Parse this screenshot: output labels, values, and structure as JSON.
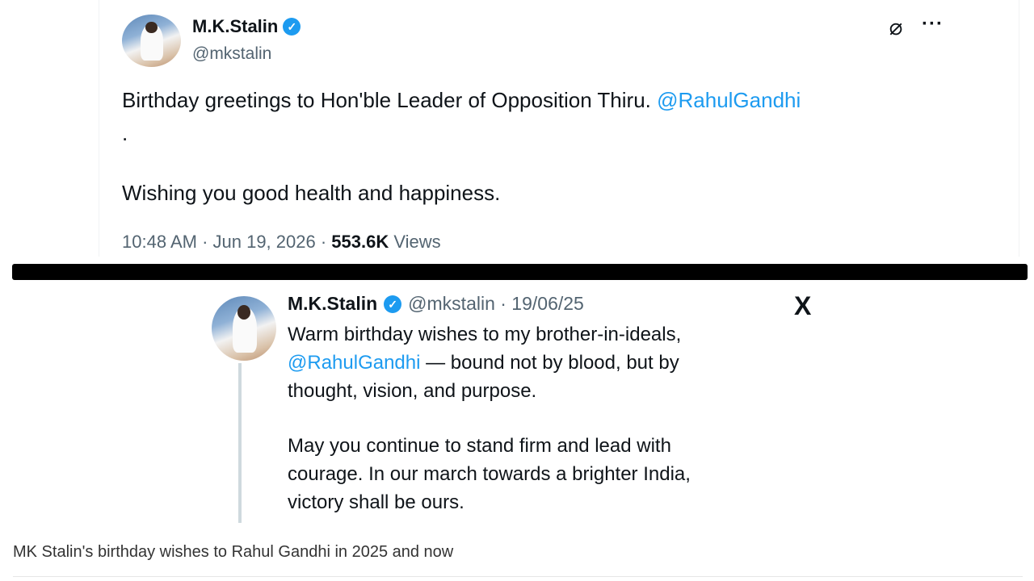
{
  "tweet_current": {
    "name": "M.K.Stalin",
    "verified_mark": "✓",
    "handle": "@mkstalin",
    "text_line1": "Birthday greetings to Hon'ble Leader of Opposition Thiru. ",
    "mention": "@RahulGandhi",
    "text_dot": ".",
    "text_line2": "Wishing you good health and happiness.",
    "time": "10:48 AM · Jun 19, 2026 · ",
    "views_count": "553.6K",
    "views_label": " Views",
    "grok_icon": "⌀",
    "more_icon": "···"
  },
  "tweet_previous": {
    "name": "M.K.Stalin",
    "verified_mark": "✓",
    "handle_date": "@mkstalin · 19/06/25",
    "p1_line1": "Warm birthday wishes to my brother-in-ideals,",
    "p1_mention": "@RahulGandhi",
    "p1_line2_rest": " — bound not by blood, but by",
    "p1_line3": "thought, vision, and purpose.",
    "p2_line1": "May you continue to stand firm and lead with",
    "p2_line2": "courage. In our march towards a brighter India,",
    "p2_line3": "victory shall be ours.",
    "x_logo": "X"
  },
  "caption": "MK Stalin's birthday wishes to Rahul Gandhi in 2025 and now",
  "colors": {
    "accent": "#1d9bf0",
    "secondary_text": "#536471",
    "primary_text": "#0f1419"
  }
}
